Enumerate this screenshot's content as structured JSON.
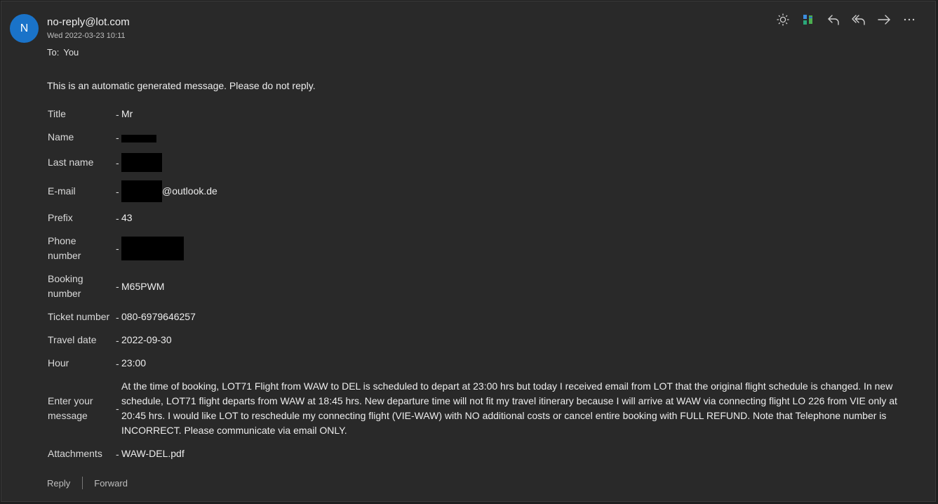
{
  "sender": {
    "avatar_letter": "N",
    "email": "no-reply@lot.com",
    "date": "Wed 2022-03-23 10:11"
  },
  "recipient": {
    "label": "To:",
    "value": "You"
  },
  "toolbar": {
    "icons": [
      "brightness-icon",
      "translate-icon",
      "reply-icon",
      "reply-all-icon",
      "forward-icon",
      "more-icon"
    ]
  },
  "intro": "This is an automatic generated message. Please do not reply.",
  "fields": {
    "title": {
      "label": "Title",
      "value": "Mr"
    },
    "name": {
      "label": "Name",
      "value": ""
    },
    "last_name": {
      "label": "Last name",
      "value": ""
    },
    "email": {
      "label": "E-mail",
      "value": "@outlook.de"
    },
    "prefix": {
      "label": "Prefix",
      "value": "43"
    },
    "phone": {
      "label": "Phone number",
      "value": ""
    },
    "booking": {
      "label": "Booking number",
      "value": "M65PWM"
    },
    "ticket": {
      "label": "Ticket number",
      "value": "080-6979646257"
    },
    "travel_date": {
      "label": "Travel date",
      "value": "2022-09-30"
    },
    "hour": {
      "label": "Hour",
      "value": "23:00"
    },
    "message": {
      "label": "Enter your message",
      "value": "At the time of booking, LOT71 Flight from WAW to DEL is scheduled to depart at 23:00 hrs but today I received email from LOT that the original flight schedule is changed. In new schedule, LOT71 flight departs from WAW at 18:45 hrs. New departure time will not fit my travel itinerary because I will arrive at WAW via connecting flight LO 226 from VIE only at 20:45 hrs. I would like LOT to reschedule my connecting flight (VIE-WAW) with NO additional costs or cancel entire booking with FULL REFUND. Note that Telephone number is INCORRECT. Please communicate via email ONLY."
    },
    "attachments": {
      "label": "Attachments",
      "value": "WAW-DEL.pdf"
    }
  },
  "separator": "-",
  "footer": {
    "reply": "Reply",
    "forward": "Forward"
  }
}
